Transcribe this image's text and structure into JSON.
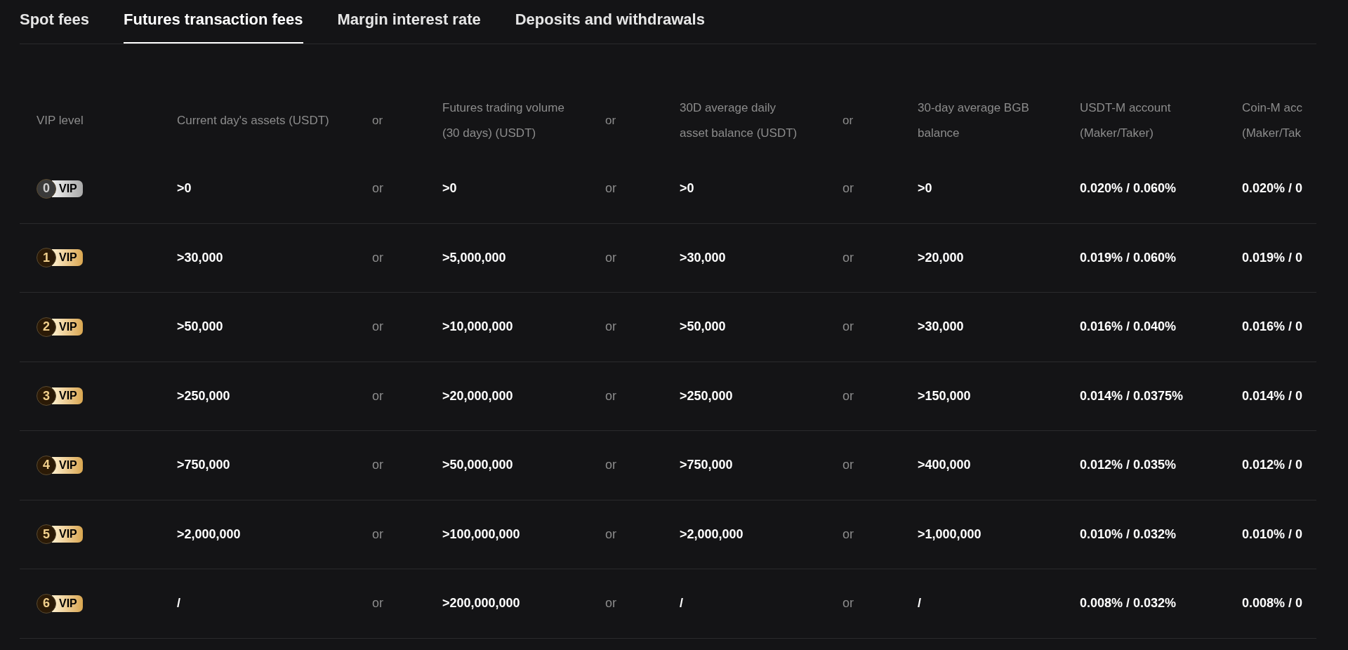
{
  "tabs": [
    {
      "label": "Spot fees",
      "selected": false
    },
    {
      "label": "Futures transaction fees",
      "selected": true
    },
    {
      "label": "Margin interest rate",
      "selected": false
    },
    {
      "label": "Deposits and withdrawals",
      "selected": false
    }
  ],
  "table": {
    "columns": [
      {
        "label": "VIP level"
      },
      {
        "label": "Current day's assets (USDT)"
      },
      {
        "label": "or"
      },
      {
        "label": "Futures trading volume (30 days) (USDT)"
      },
      {
        "label": "or"
      },
      {
        "label": "30D average daily asset balance (USDT)"
      },
      {
        "label": "or"
      },
      {
        "label": "30-day average BGB balance"
      },
      {
        "label": "USDT-M account (Maker/Taker)"
      },
      {
        "label": "Coin-M acc (Maker/Tak"
      }
    ],
    "rows": [
      {
        "cells": [
          {
            "level": "0",
            "badge": "VIP",
            "kind": "silver"
          },
          ">0",
          "or",
          ">0",
          "or",
          ">0",
          "or",
          ">0",
          "0.020% / 0.060%",
          "0.020% / 0"
        ]
      },
      {
        "cells": [
          {
            "level": "1",
            "badge": "VIP",
            "kind": "gold"
          },
          ">30,000",
          "or",
          ">5,000,000",
          "or",
          ">30,000",
          "or",
          ">20,000",
          "0.019% / 0.060%",
          "0.019% / 0"
        ]
      },
      {
        "cells": [
          {
            "level": "2",
            "badge": "VIP",
            "kind": "gold"
          },
          ">50,000",
          "or",
          ">10,000,000",
          "or",
          ">50,000",
          "or",
          ">30,000",
          "0.016% / 0.040%",
          "0.016% / 0"
        ]
      },
      {
        "cells": [
          {
            "level": "3",
            "badge": "VIP",
            "kind": "gold"
          },
          ">250,000",
          "or",
          ">20,000,000",
          "or",
          ">250,000",
          "or",
          ">150,000",
          "0.014% / 0.0375%",
          "0.014% / 0"
        ]
      },
      {
        "cells": [
          {
            "level": "4",
            "badge": "VIP",
            "kind": "gold"
          },
          ">750,000",
          "or",
          ">50,000,000",
          "or",
          ">750,000",
          "or",
          ">400,000",
          "0.012% / 0.035%",
          "0.012% / 0"
        ]
      },
      {
        "cells": [
          {
            "level": "5",
            "badge": "VIP",
            "kind": "gold"
          },
          ">2,000,000",
          "or",
          ">100,000,000",
          "or",
          ">2,000,000",
          "or",
          ">1,000,000",
          "0.010% / 0.032%",
          "0.010% / 0"
        ]
      },
      {
        "cells": [
          {
            "level": "6",
            "badge": "VIP",
            "kind": "gold"
          },
          "/",
          "or",
          ">200,000,000",
          "or",
          "/",
          "or",
          "/",
          "0.008% / 0.032%",
          "0.008% / 0"
        ]
      }
    ]
  }
}
